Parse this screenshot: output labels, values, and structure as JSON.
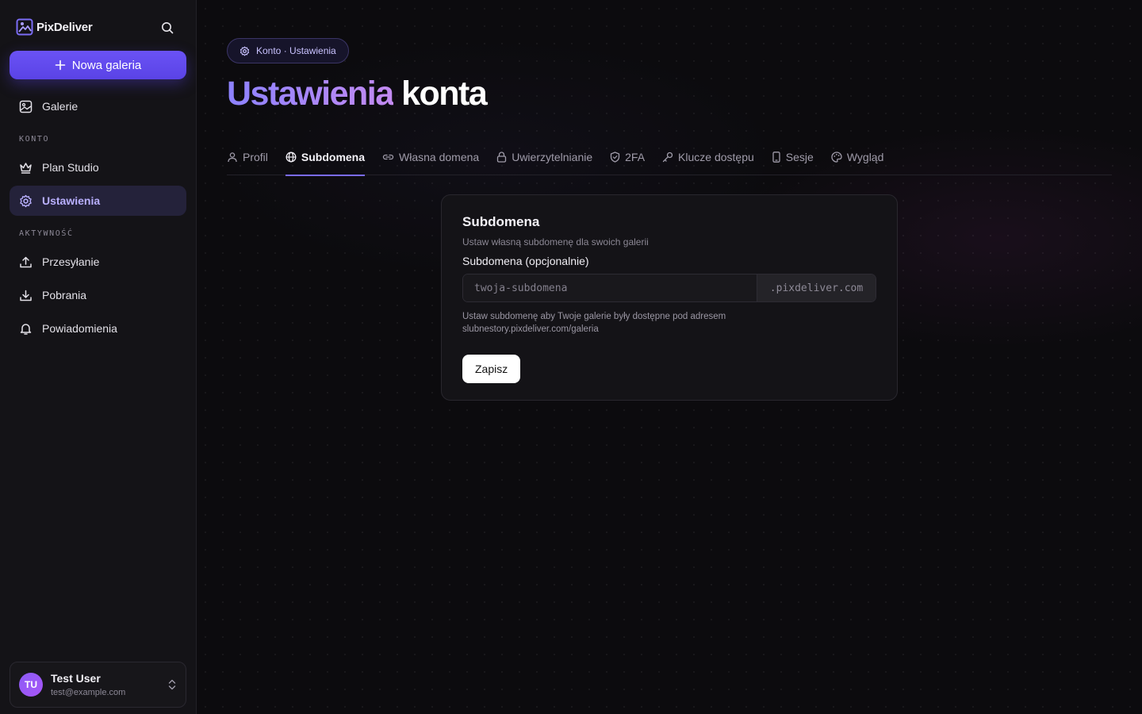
{
  "app": {
    "name": "PixDeliver"
  },
  "sidebar": {
    "new_gallery_label": "Nowa galeria",
    "items": {
      "galleries": "Galerie",
      "plan": "Plan Studio",
      "settings": "Ustawienia",
      "uploads": "Przesyłanie",
      "downloads": "Pobrania",
      "notifications": "Powiadomienia"
    },
    "sections": {
      "account": "KONTO",
      "activity": "AKTYWNOŚĆ"
    },
    "icons": [
      "image-icon",
      "crown-icon",
      "gear-icon",
      "upload-icon",
      "download-icon",
      "bell-icon"
    ]
  },
  "user": {
    "initials": "TU",
    "name": "Test User",
    "email": "test@example.com"
  },
  "breadcrumb": {
    "text": "Konto · Ustawienia"
  },
  "page": {
    "title_highlight": "Ustawienia",
    "title_rest": "konta"
  },
  "tabs": [
    {
      "label": "Profil",
      "icon": "user-icon"
    },
    {
      "label": "Subdomena",
      "icon": "globe-icon",
      "active": true
    },
    {
      "label": "Własna domena",
      "icon": "link-icon"
    },
    {
      "label": "Uwierzytelnianie",
      "icon": "lock-icon"
    },
    {
      "label": "2FA",
      "icon": "shield-icon"
    },
    {
      "label": "Klucze dostępu",
      "icon": "key-icon"
    },
    {
      "label": "Sesje",
      "icon": "phone-icon"
    },
    {
      "label": "Wygląd",
      "icon": "palette-icon"
    }
  ],
  "card": {
    "title": "Subdomena",
    "description": "Ustaw własną subdomenę dla swoich galerii",
    "field_label": "Subdomena (opcjonalnie)",
    "input_placeholder": "twoja-subdomena",
    "input_value": "",
    "suffix": ".pixdeliver.com",
    "helper": "Ustaw subdomenę aby Twoje galerie były dostępne pod adresem slubnestory.pixdeliver.com/galeria",
    "save_label": "Zapisz"
  },
  "colors": {
    "accent": "#6a52f5",
    "active_nav_bg": "#24223a",
    "background": "#0c0b0e"
  }
}
